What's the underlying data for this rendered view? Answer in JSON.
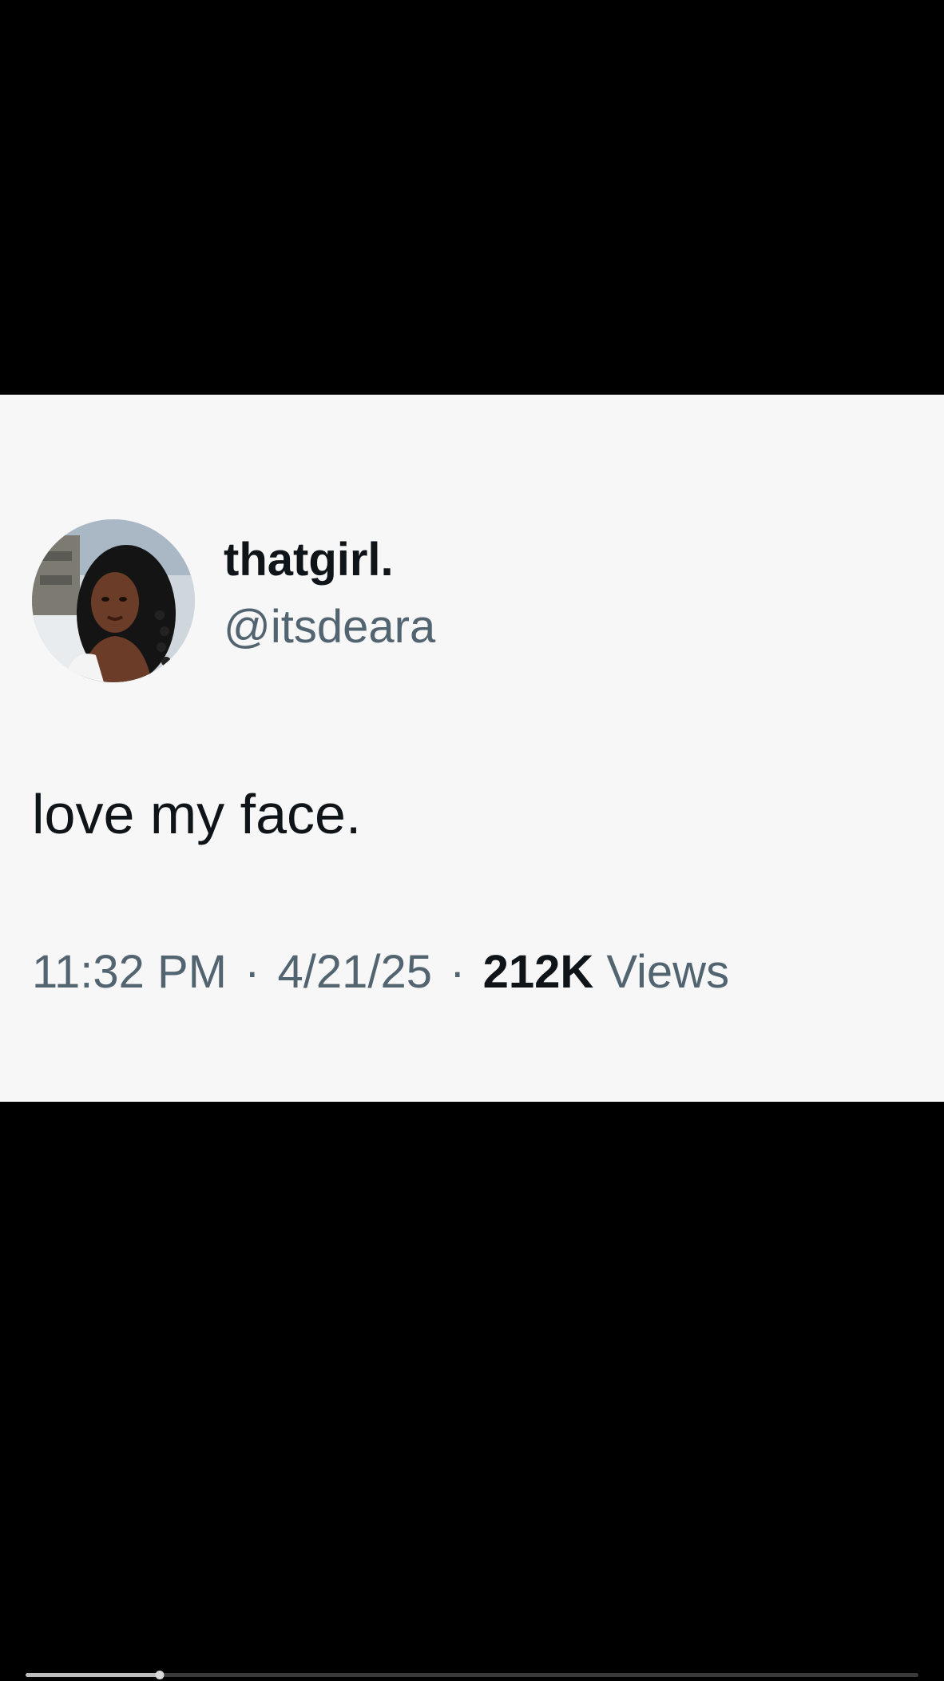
{
  "tweet": {
    "display_name": "thatgirl.",
    "handle": "@itsdeara",
    "text": "love my face.",
    "time": "11:32 PM",
    "separator": "·",
    "date": "4/21/25",
    "views_count": "212K",
    "views_label": "Views",
    "avatar_icon": "profile-photo-avatar"
  },
  "video_player": {
    "progress_fraction": 0.15
  },
  "colors": {
    "card_background": "#f7f7f8",
    "primary_text": "#0f1419",
    "secondary_text": "#536471",
    "frame_background": "#000000"
  }
}
